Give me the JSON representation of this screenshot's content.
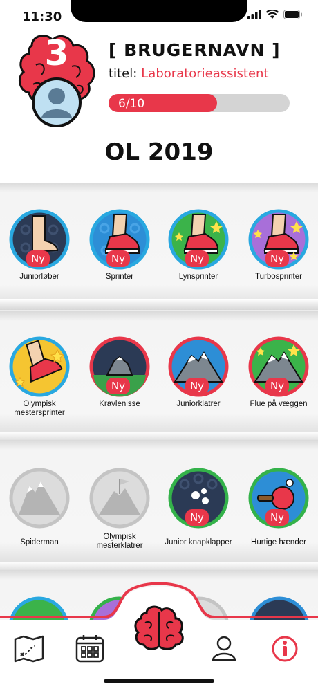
{
  "status_bar": {
    "time": "11:30"
  },
  "profile": {
    "level": "3",
    "username": "[ BRUGERNAVN ]",
    "title_label": "titel:",
    "title_value": "Laboratorieassistent",
    "progress_text": "6/10",
    "progress_fraction": 0.6
  },
  "page_title": "OL 2019",
  "colors": {
    "accent": "#e8374a",
    "blue_ring": "#29a8e0",
    "red_ring": "#e8374a",
    "green_ring": "#34b24a",
    "grey": "#cfcfcf"
  },
  "rows": [
    {
      "badges": [
        {
          "label": "Juniorløber",
          "new": "Ny",
          "icon": "foot-icon"
        },
        {
          "label": "Sprinter",
          "new": "Ny",
          "icon": "sneaker-icon"
        },
        {
          "label": "Lynsprinter",
          "new": "Ny",
          "icon": "sneaker-stars-icon"
        },
        {
          "label": "Turbosprinter",
          "new": "Ny",
          "icon": "sneaker-stars-icon"
        }
      ]
    },
    {
      "badges": [
        {
          "label": "Olympisk mestersprinter",
          "icon": "sneaker-stars-icon"
        },
        {
          "label": "Kravlenisse",
          "new": "Ny",
          "icon": "rock-icon"
        },
        {
          "label": "Juniorklatrer",
          "new": "Ny",
          "icon": "mountain-icon"
        },
        {
          "label": "Flue på væggen",
          "new": "Ny",
          "icon": "mountain-stars-icon"
        }
      ]
    },
    {
      "badges": [
        {
          "label": "Spiderman",
          "icon": "mountain-locked-icon"
        },
        {
          "label": "Olympisk mesterklatrer",
          "icon": "mountain-flag-locked-icon"
        },
        {
          "label": "Junior knapklapper",
          "new": "Ny",
          "icon": "dots-icon"
        },
        {
          "label": "Hurtige hænder",
          "new": "Ny",
          "icon": "ping-pong-icon"
        }
      ]
    }
  ],
  "tabbar": {
    "items": [
      "map-icon",
      "calendar-icon",
      "brain-icon",
      "profile-icon",
      "info-icon"
    ]
  }
}
